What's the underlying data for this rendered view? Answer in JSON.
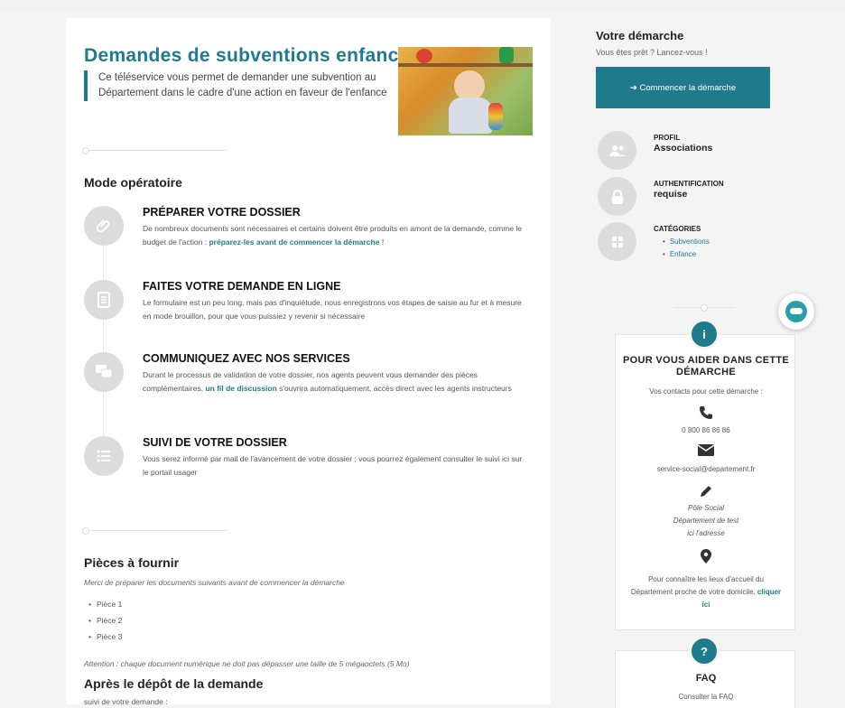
{
  "main": {
    "title": "Demandes de subventions enfance",
    "intro": "Ce téléservice vous permet de demander une subvention au Département dans le cadre d'une action en faveur de l'enfance",
    "mode_title": "Mode opératoire",
    "steps": [
      {
        "icon": "paperclip-icon",
        "title": "PRÉPARER VOTRE DOSSIER",
        "text_before": "De nombreux documents sont nécessaires et certains doivent être produits en amont de la demande, comme le budget de l'action : ",
        "link": "préparez-les avant de commencer la démarche",
        "text_after": " !"
      },
      {
        "icon": "form-icon",
        "title": "FAITES VOTRE DEMANDE EN LIGNE",
        "text": "Le formulaire est un peu long, mais pas d'inquiétude, nous enregistrons vos étapes de saisie au fur et à mesure en mode brouillon, pour que vous puissiez y revenir si nécessaire"
      },
      {
        "icon": "chat-icon",
        "title": "COMMUNIQUEZ AVEC NOS SERVICES",
        "text_before": "Durant le processus de validation de votre dossier, nos agents peuvent vous demander des pièces complémentaires, ",
        "link": "un fil de discussion",
        "text_after": " s'ouvrira automatiquement, accès direct avec les agents instructeurs"
      },
      {
        "icon": "list-icon",
        "title": "SUIVI DE VOTRE DOSSIER",
        "text": "Vous serez informé par mail de l'avancement de votre dossier ; vous pourrez également consulter le suivi ici sur le portail usager"
      }
    ],
    "pieces_title": "Pièces à fournir",
    "pieces_intro": "Merci de préparer les documents suivants avant de commencer la démarche",
    "pieces": [
      "Pièce 1",
      "Pièce 2",
      "Pièce 3"
    ],
    "attention": "Attention : chaque document numérique ne doit pas dépasser une taille de 5 mégaoctets (5 Mo)",
    "apres_title": "Après le dépôt de la demande",
    "apres_text": "suivi de votre demande :"
  },
  "sidebar": {
    "title": "Votre démarche",
    "subtitle": "Vous êtes prêt ? Lancez-vous !",
    "start_button": "➔ Commencer la démarche",
    "profil_label": "PROFIL",
    "profil_value": "Associations",
    "auth_label": "AUTHENTIFICATION",
    "auth_value": "requise",
    "cat_label": "CATÉGORIES",
    "categories": [
      "Subventions",
      "Enfance"
    ]
  },
  "help": {
    "badge": "i",
    "title": "POUR VOUS AIDER DANS CETTE DÉMARCHE",
    "subtitle": "Vos contacts pour cette démarche :",
    "phone": "0 800 86 86 86",
    "email": "service-social@departement.fr",
    "address_line1": "Pôle Social",
    "address_line2": "Département de test",
    "address_line3": "ici l'adresse",
    "location_text": "Pour connaître les lieux d'accueil du Département proche de votre domicile, ",
    "location_link": "cliquer ici"
  },
  "faq": {
    "badge": "?",
    "title": "FAQ",
    "subtitle": "Consulter la FAQ"
  },
  "colors": {
    "accent": "#1f7a8c",
    "icon_bg": "#dcdcdc"
  }
}
